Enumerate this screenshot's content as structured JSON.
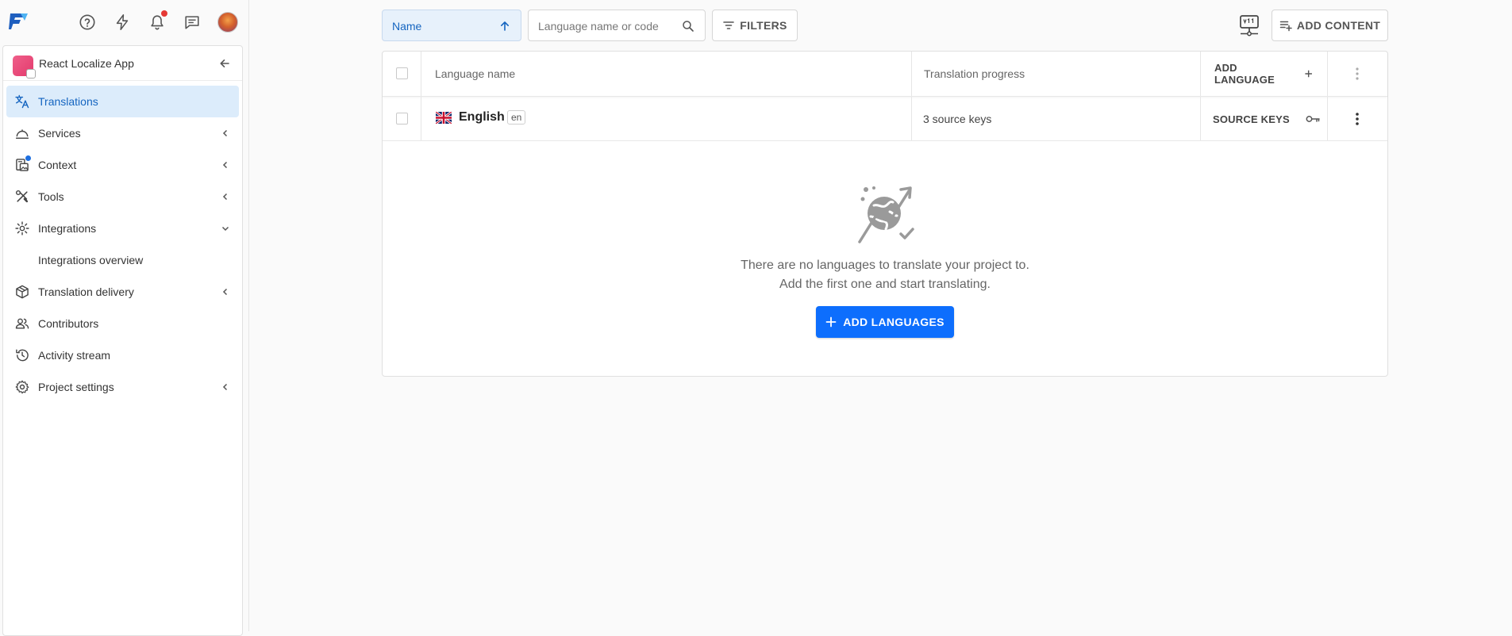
{
  "sidebar": {
    "project_name": "React Localize App",
    "items": [
      {
        "label": "Translations",
        "icon": "translate-icon"
      },
      {
        "label": "Services",
        "icon": "services-icon"
      },
      {
        "label": "Context",
        "icon": "context-icon"
      },
      {
        "label": "Tools",
        "icon": "tools-icon"
      },
      {
        "label": "Integrations",
        "icon": "integrations-icon"
      },
      {
        "label": "Integrations overview"
      },
      {
        "label": "Translation delivery",
        "icon": "delivery-icon"
      },
      {
        "label": "Contributors",
        "icon": "contributors-icon"
      },
      {
        "label": "Activity stream",
        "icon": "history-icon"
      },
      {
        "label": "Project settings",
        "icon": "gear-icon"
      }
    ]
  },
  "toolbar": {
    "sort_label": "Name",
    "search_placeholder": "Language name or code",
    "filters_label": "FILTERS",
    "add_content_label": "ADD CONTENT"
  },
  "table": {
    "headers": {
      "language_name": "Language name",
      "translation_progress": "Translation progress",
      "add_language": "ADD LANGUAGE"
    },
    "rows": [
      {
        "name": "English",
        "code": "en",
        "progress": "3 source keys",
        "action": "SOURCE KEYS"
      }
    ]
  },
  "empty_state": {
    "line1": "There are no languages to translate your project to.",
    "line2": "Add the first one and start translating.",
    "button": "ADD LANGUAGES"
  },
  "colors": {
    "accent": "#0d6efd",
    "active_bg": "#dcecfb",
    "notification": "#e53935"
  }
}
